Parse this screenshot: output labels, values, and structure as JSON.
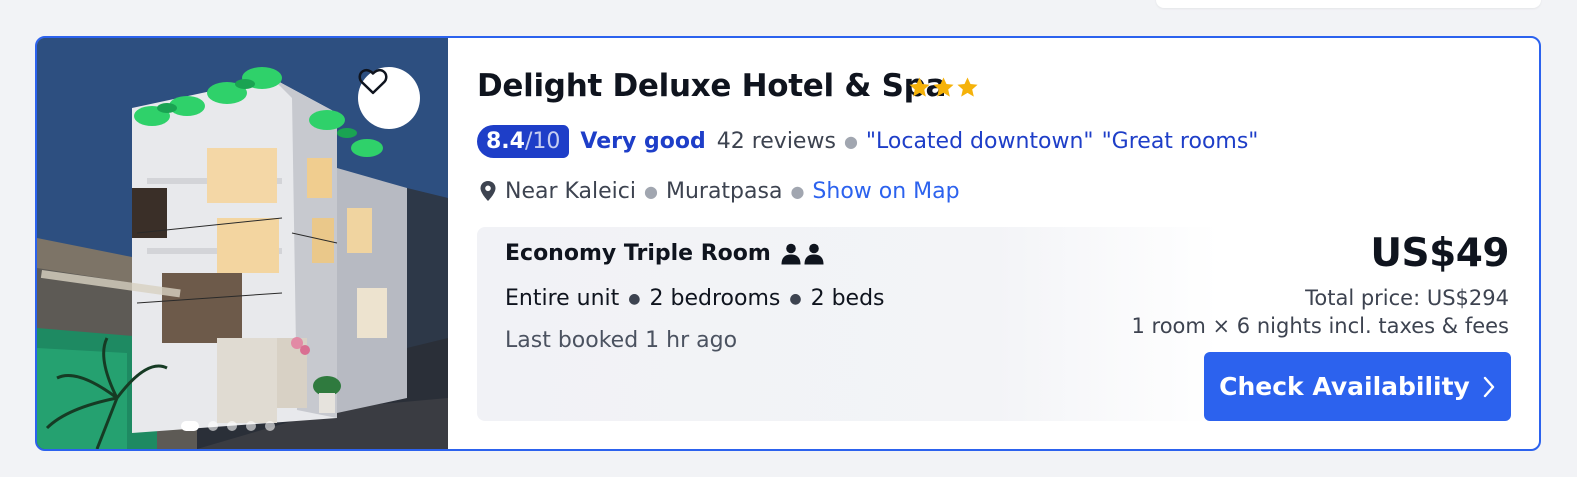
{
  "hotel": {
    "name": "Delight Deluxe Hotel & Spa",
    "star_count": 3,
    "star_color": "#f5b20a",
    "rating": {
      "score": "8.4",
      "out_of": "/10",
      "label": "Very good",
      "reviews": "42 reviews",
      "highlights": [
        "\"Located downtown\"",
        "\"Great rooms\""
      ]
    },
    "location": {
      "icon": "map-pin-icon",
      "area": "Near Kaleici",
      "district": "Muratpasa",
      "map_link": "Show on Map"
    },
    "photo": {
      "favorite_icon": "heart-outline-icon",
      "carousel_dots": 5,
      "active_dot": 0
    },
    "room": {
      "title": "Economy Triple Room",
      "occupancy_icon": "two-person-icon",
      "details": [
        "Entire unit",
        "2 bedrooms",
        "2 beds"
      ],
      "last_booked": "Last booked 1 hr ago"
    },
    "pricing": {
      "price": "US$49",
      "total": "Total price: US$294",
      "stay": "1 room × 6 nights incl. taxes & fees"
    },
    "cta": {
      "label": "Check Availability",
      "icon": "chevron-right-icon"
    }
  },
  "colors": {
    "accent": "#2c62ee",
    "rating_blue": "#1e3ec8",
    "background": "#f2f3f6"
  }
}
